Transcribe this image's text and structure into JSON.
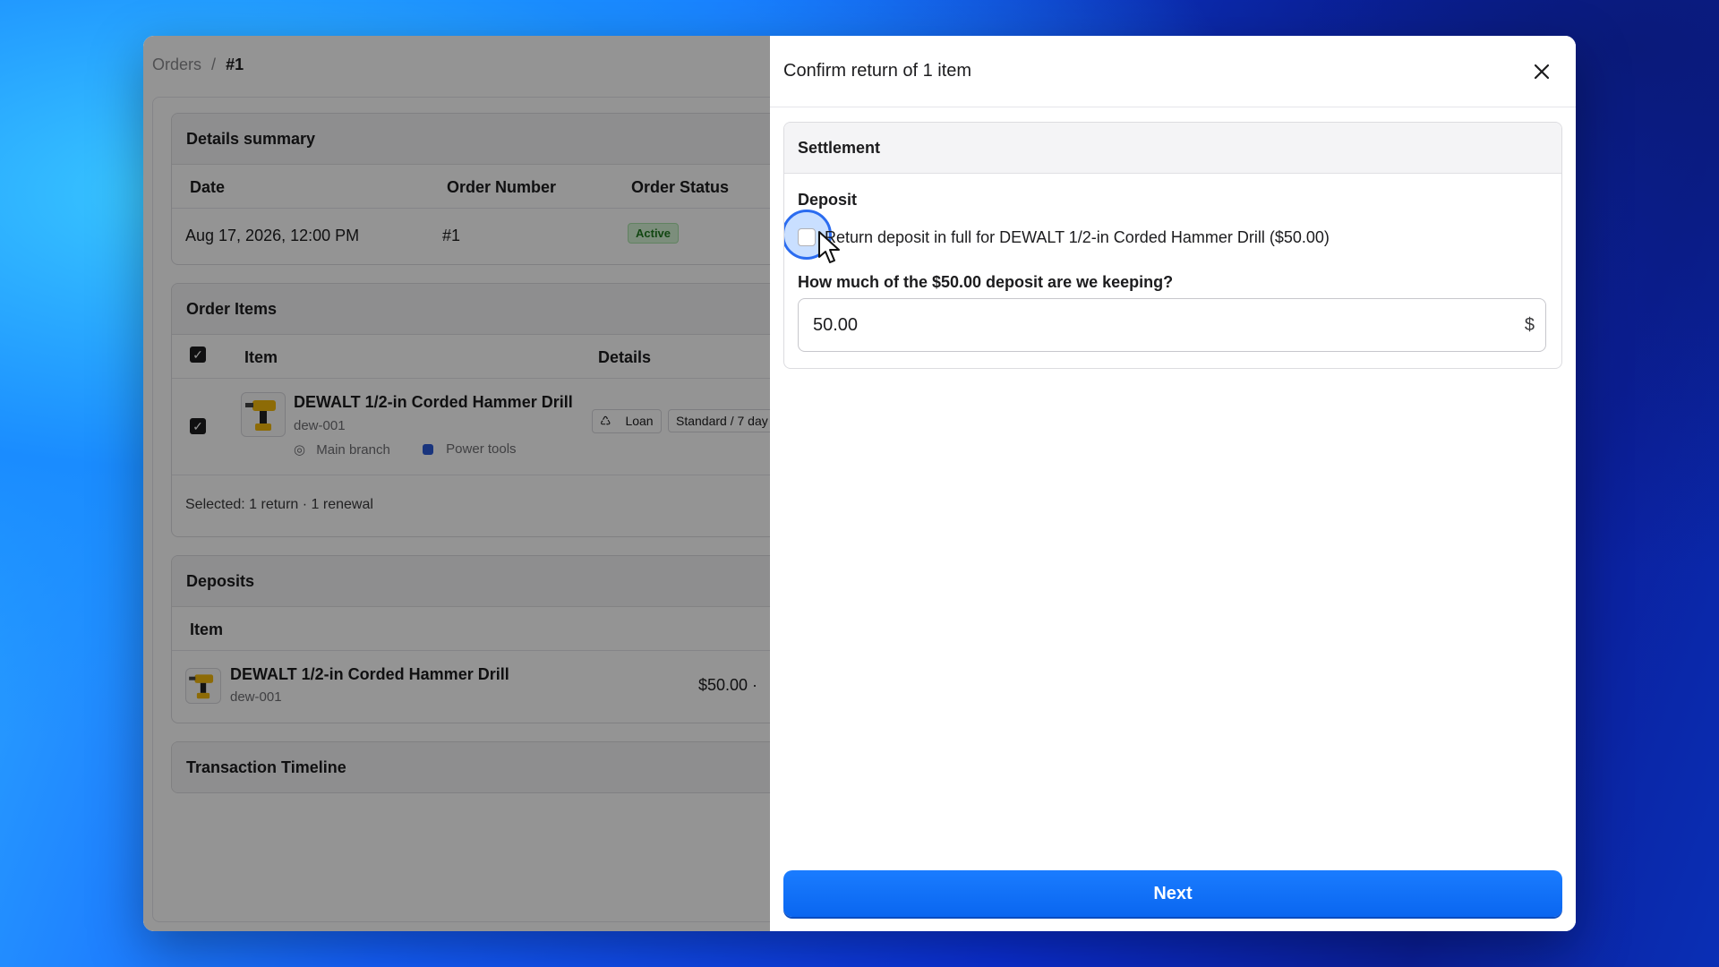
{
  "breadcrumb": {
    "parent": "Orders",
    "separator": "/",
    "current": "#1"
  },
  "details_summary": {
    "title": "Details summary",
    "headers": [
      "Date",
      "Order Number",
      "Order Status"
    ],
    "row": {
      "date": "Aug 17, 2026, 12:00 PM",
      "order_number": "#1",
      "status": "Active"
    }
  },
  "order_items": {
    "title": "Order Items",
    "headers": {
      "item": "Item",
      "details": "Details"
    },
    "item": {
      "name": "DEWALT 1/2-in Corded Hammer Drill",
      "sku": "dew-001",
      "location": "Main branch",
      "category": "Power tools",
      "category_color": "#2c5bd8",
      "tag_loan": "Loan",
      "tag_standard": "Standard / 7 day"
    },
    "selected_summary": "Selected: 1 return · 1 renewal"
  },
  "deposits": {
    "title": "Deposits",
    "headers": {
      "item": "Item"
    },
    "item": {
      "name": "DEWALT 1/2-in Corded Hammer Drill",
      "sku": "dew-001",
      "amount": "$50.00 ·"
    }
  },
  "timeline": {
    "title": "Transaction Timeline"
  },
  "panel": {
    "title": "Confirm return of 1 item",
    "settlement_title": "Settlement",
    "deposit_label": "Deposit",
    "return_checkbox_label": "Return deposit in full for DEWALT 1/2-in Corded Hammer Drill ($50.00)",
    "return_checkbox_checked": false,
    "question": "How much of the $50.00 deposit are we keeping?",
    "amount_value": "50.00",
    "currency_symbol": "$",
    "next_label": "Next"
  },
  "colors": {
    "accent": "#0a66f0",
    "active_badge_bg": "#d6f5d6",
    "active_badge_text": "#1f7a1f"
  }
}
